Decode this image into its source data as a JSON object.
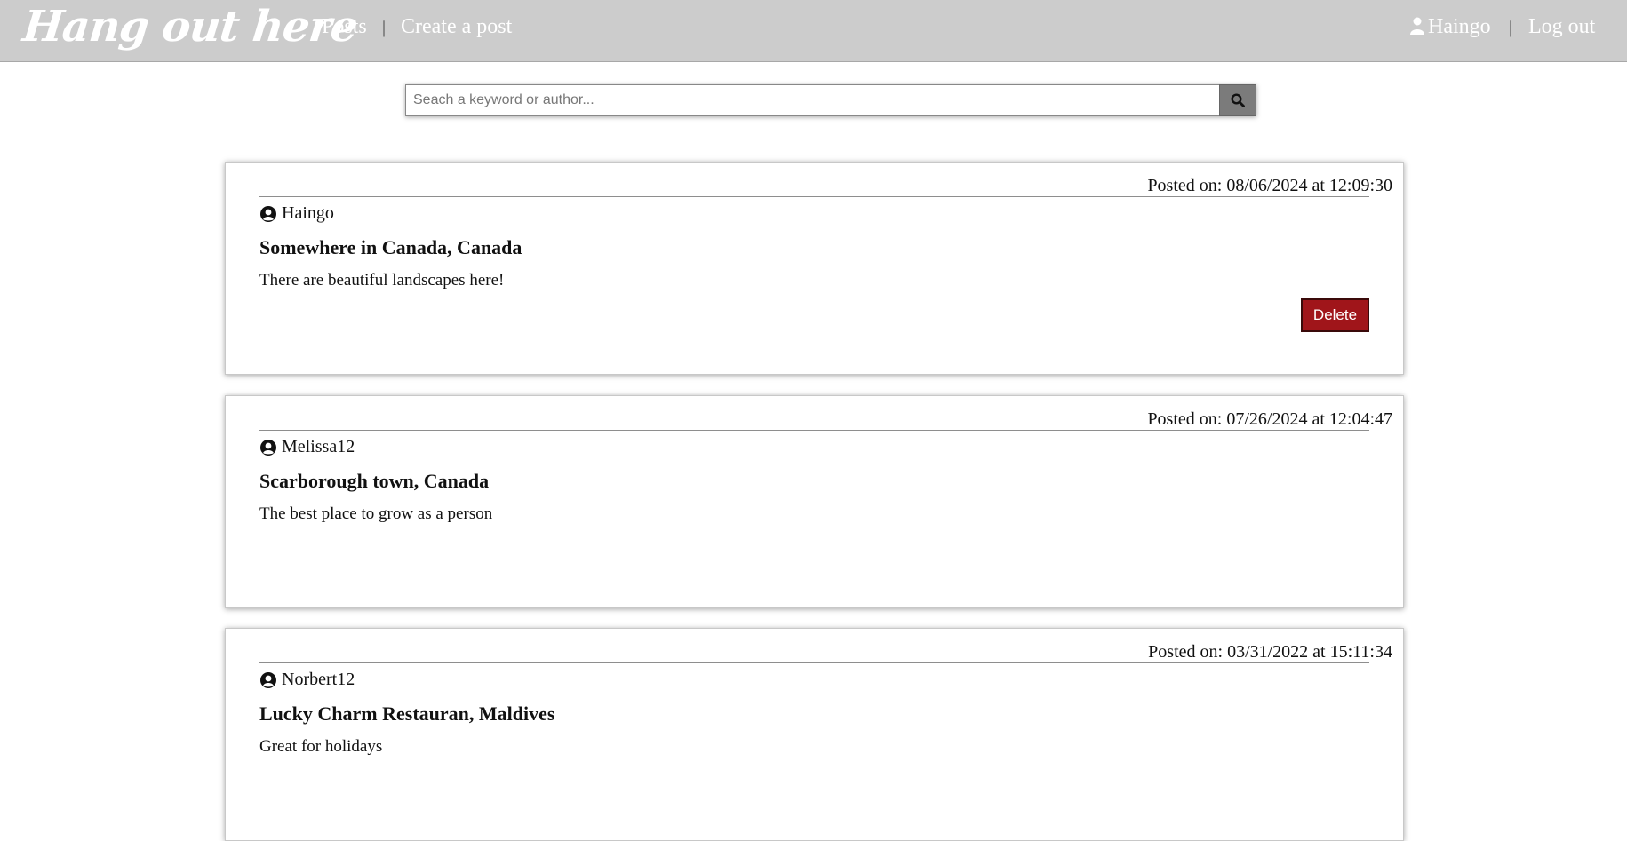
{
  "header": {
    "logo": "Hang out here",
    "nav": [
      {
        "label": "Posts"
      },
      {
        "label": "Create a post"
      }
    ],
    "separator": "|",
    "user": {
      "name": "Haingo",
      "icon": "user-icon"
    },
    "logout_label": "Log out"
  },
  "search": {
    "placeholder": "Seach a keyword or author...",
    "value": "",
    "button_icon": "search-icon"
  },
  "posts": [
    {
      "date_text": "Posted on: 08/06/2024 at 12:09:30",
      "author": "Haingo",
      "title": "Somewhere in Canada, Canada",
      "body": "There are beautiful landscapes here!",
      "delete_label": "Delete"
    },
    {
      "date_text": "Posted on: 07/26/2024 at 12:04:47",
      "author": "Melissa12",
      "title": "Scarborough town, Canada",
      "body": "The best place to grow as a person"
    },
    {
      "date_text": "Posted on: 03/31/2022 at 15:11:34",
      "author": "Norbert12",
      "title": "Lucky Charm Restauran, Maldives",
      "body": "Great for holidays"
    }
  ],
  "colors": {
    "header_bg": "#cccccc",
    "delete_bg": "#a0151a",
    "search_btn_bg": "#7b7b7b"
  }
}
